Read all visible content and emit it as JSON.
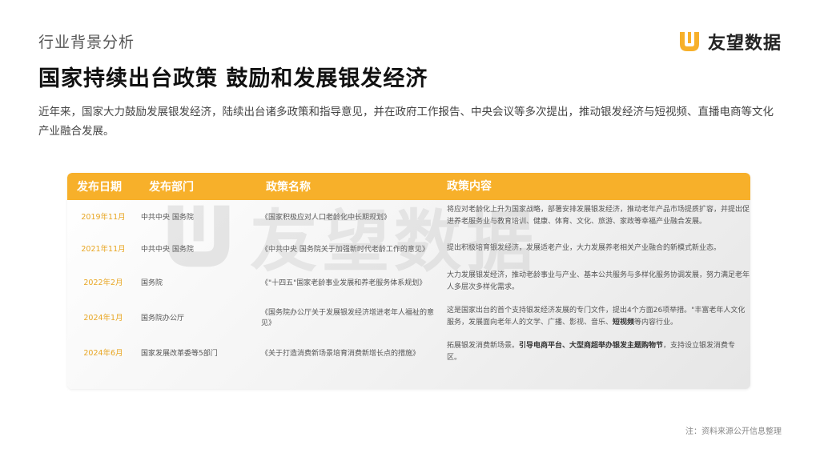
{
  "header": {
    "section_label": "行业背景分析",
    "title": "国家持续出台政策  鼓励和发展银发经济"
  },
  "logo": {
    "text": "友望数据",
    "mark_color": "#f7b02a"
  },
  "intro": "近年来，国家大力鼓励发展银发经济，陆续出台诸多政策和指导意见，并在政府工作报告、中央会议等多次提出，推动银发经济与短视频、直播电商等文化产业融合发展。",
  "table": {
    "header_color": "#f7b02a",
    "columns": [
      "发布日期",
      "发布部门",
      "政策名称",
      "政策内容"
    ],
    "rows": [
      {
        "date": "2019年11月",
        "dept": "中共中央  国务院",
        "name": "《国家积极应对人口老龄化中长期规划》",
        "content": "将应对老龄化上升为国家战略，部署安排发展银发经济，推动老年产品市场提质扩容，并提出促进养老服务业与教育培训、健康、体育、文化、旅游、家政等幸福产业融合发展。"
      },
      {
        "date": "2021年11月",
        "dept": "中共中央  国务院",
        "name": "《中共中央 国务院关于加强新时代老龄工作的意见》",
        "content": "提出积极培育银发经济，发展适老产业，大力发展养老相关产业融合的新模式新业态。"
      },
      {
        "date": "2022年2月",
        "dept": "国务院",
        "name": "《\"十四五\"国家老龄事业发展和养老服务体系规划》",
        "content": "大力发展银发经济，推动老龄事业与产业、基本公共服务与多样化服务协调发展，努力满足老年人多层次多样化需求。"
      },
      {
        "date": "2024年1月",
        "dept": "国务院办公厅",
        "name": "《国务院办公厅关于发展银发经济增进老年人福祉的意见》",
        "content_parts": [
          "这是国家出台的首个支持银发经济发展的专门文件，提出4个方面26项举措。\"丰富老年人文化服务，发展面向老年人的文学、广播、影视、音乐、",
          "短视频",
          "等内容行业。"
        ]
      },
      {
        "date": "2024年6月",
        "dept": "国家发展改革委等5部门",
        "name": "《关于打造消费新场景培育消费新增长点的措施》",
        "content_parts": [
          "拓展银发消费新场景。",
          "引导电商平台、大型商超举办银发主题购物节",
          "，支持设立银发消费专区。"
        ]
      }
    ]
  },
  "watermark": {
    "text": "友望数据"
  },
  "note": "注：资料来源公开信息整理"
}
